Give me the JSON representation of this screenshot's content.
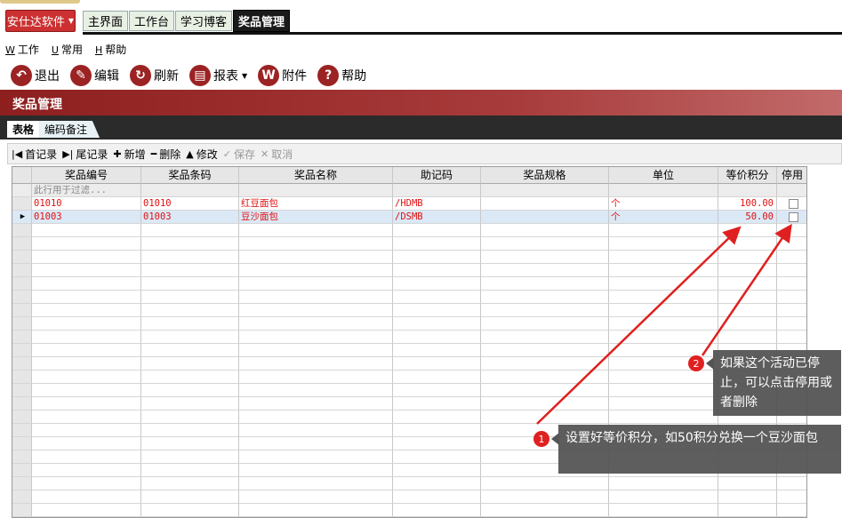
{
  "app": {
    "brand_button": "安仕达软件"
  },
  "tabs": [
    "主界面",
    "工作台",
    "学习博客",
    "奖品管理"
  ],
  "menu": [
    {
      "key": "W",
      "label": "工作"
    },
    {
      "key": "U",
      "label": "常用"
    },
    {
      "key": "H",
      "label": "帮助"
    }
  ],
  "toolbar": [
    {
      "label": "退出",
      "icon": "exit-icon"
    },
    {
      "label": "编辑",
      "icon": "edit-icon"
    },
    {
      "label": "刷新",
      "icon": "refresh-icon"
    },
    {
      "label": "报表",
      "icon": "printer-icon"
    },
    {
      "label": "附件",
      "icon": "attachment-icon"
    },
    {
      "label": "帮助",
      "icon": "help-icon"
    }
  ],
  "page_title": "奖品管理",
  "subtabs": [
    "表格",
    "编码备注"
  ],
  "grid_toolbar": {
    "first": "首记录",
    "last": "尾记录",
    "add": "新增",
    "delete": "删除",
    "modify": "修改",
    "save": "保存",
    "cancel": "取消"
  },
  "table": {
    "columns": [
      "奖品编号",
      "奖品条码",
      "奖品名称",
      "助记码",
      "奖品规格",
      "单位",
      "等价积分",
      "停用"
    ],
    "filter_hint": "此行用于过滤...",
    "rows": [
      {
        "code": "01010",
        "barcode": "01010",
        "name": "红豆面包",
        "mnemonic": "/HDMB",
        "spec": "",
        "unit": "个",
        "points": "100.00",
        "disabled": false
      },
      {
        "code": "01003",
        "barcode": "01003",
        "name": "豆沙面包",
        "mnemonic": "/DSMB",
        "spec": "",
        "unit": "个",
        "points": "50.00",
        "disabled": false
      }
    ]
  },
  "annotations": [
    {
      "badge": "1",
      "text": "设置好等价积分，如50积分兑换一个豆沙面包"
    },
    {
      "badge": "2",
      "text": "如果这个活动已停止，可以点击停用或者删除"
    }
  ],
  "colors": {
    "accent": "#9b2323",
    "annotation_red": "#e02020",
    "callout_bg": "#555555"
  }
}
